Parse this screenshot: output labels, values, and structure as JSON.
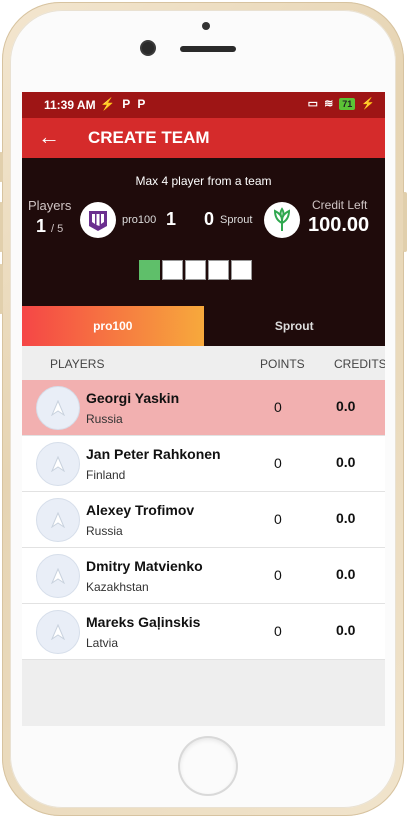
{
  "status": {
    "time": "11:39 AM",
    "left_icons": "⚡ P P",
    "battery": "71"
  },
  "header": {
    "title": "CREATE TEAM"
  },
  "team_info": {
    "max_text": "Max 4 player from a team",
    "players_label": "Players",
    "players_selected": "1",
    "players_total": "/ 5",
    "team_a": {
      "name": "pro100",
      "count": "1"
    },
    "team_b": {
      "name": "Sprout",
      "count": "0"
    },
    "credit_label": "Credit Left",
    "credit_value": "100.00",
    "slots_filled": 1,
    "slots_total": 5
  },
  "tabs": [
    {
      "label": "pro100"
    },
    {
      "label": "Sprout"
    }
  ],
  "table": {
    "headers": {
      "players": "PLAYERS",
      "points": "POINTS",
      "credits": "CREDITS"
    },
    "rows": [
      {
        "name": "Georgi Yaskin",
        "country": "Russia",
        "points": "0",
        "credits": "0.0",
        "selected": true
      },
      {
        "name": "Jan Peter Rahkonen",
        "country": "Finland",
        "points": "0",
        "credits": "0.0",
        "selected": false
      },
      {
        "name": "Alexey Trofimov",
        "country": "Russia",
        "points": "0",
        "credits": "0.0",
        "selected": false
      },
      {
        "name": "Dmitry Matvienko",
        "country": "Kazakhstan",
        "points": "0",
        "credits": "0.0",
        "selected": false
      },
      {
        "name": "Mareks Gaļinskis",
        "country": "Latvia",
        "points": "0",
        "credits": "0.0",
        "selected": false
      }
    ]
  },
  "colors": {
    "statusbar": "#9e1515",
    "appbar": "#d52b2b",
    "panel": "#1f0b0b",
    "selected_row": "#f2b0b0",
    "slot_filled": "#5fbf6a"
  }
}
